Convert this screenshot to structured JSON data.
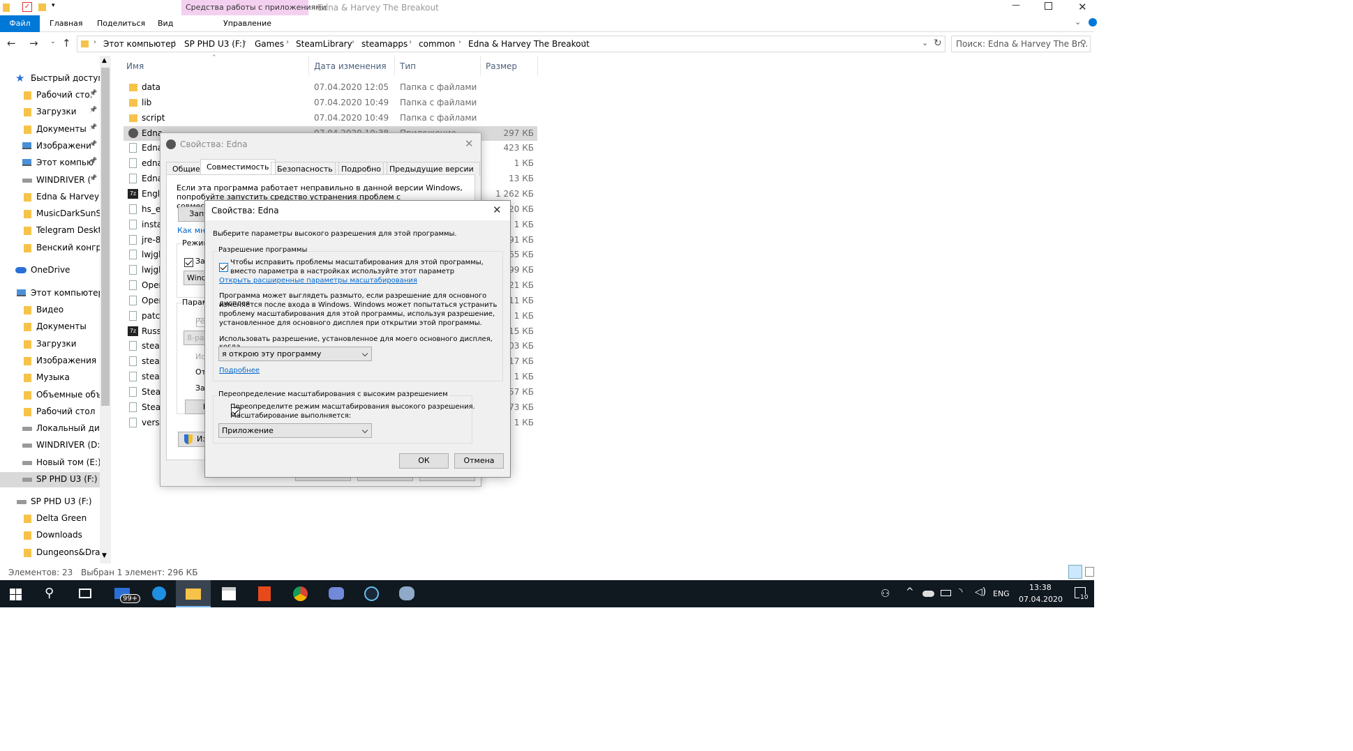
{
  "window": {
    "title": "Edna & Harvey The Breakout",
    "context_tab_group": "Средства работы с приложениями"
  },
  "ribbon": {
    "tabs": [
      "Файл",
      "Главная",
      "Поделиться",
      "Вид"
    ],
    "context_tab": "Управление"
  },
  "address": {
    "crumbs": [
      "Этот компьютер",
      "SP PHD U3 (F:)",
      "Games",
      "SteamLibrary",
      "steamapps",
      "common",
      "Edna & Harvey The Breakout"
    ],
    "search_placeholder": "Поиск: Edna & Harvey The Br..."
  },
  "nav": {
    "quick_access": "Быстрый доступ",
    "quick": [
      "Рабочий сто.",
      "Загрузки",
      "Документы",
      "Изображени",
      "Этот компью",
      "WINDRIVER (",
      "Edna & Harvey T",
      "MusicDarkSunSp",
      "Telegram Deskto",
      "Венский конгре"
    ],
    "onedrive": "OneDrive",
    "this_pc": "Этот компьютер",
    "pc": [
      "Видео",
      "Документы",
      "Загрузки",
      "Изображения",
      "Музыка",
      "Объемные объ",
      "Рабочий стол",
      "Локальный дис",
      "WINDRIVER (D:)",
      "Новый том (E:)",
      "SP PHD U3 (F:)"
    ],
    "drive": "SP PHD U3 (F:)",
    "drive_items": [
      "Delta Green",
      "Downloads",
      "Dungeons&Drag"
    ]
  },
  "columns": {
    "name": "Имя",
    "date": "Дата изменения",
    "type": "Тип",
    "size": "Размер"
  },
  "files": [
    {
      "name": "data",
      "date": "07.04.2020 12:05",
      "type": "Папка с файлами",
      "size": ""
    },
    {
      "name": "lib",
      "date": "07.04.2020 10:49",
      "type": "Папка с файлами",
      "size": ""
    },
    {
      "name": "script",
      "date": "07.04.2020 10:49",
      "type": "Папка с файлами",
      "size": ""
    },
    {
      "name": "Edna",
      "date": "07.04.2020 10:38",
      "type": "Приложение",
      "size": "297 КБ"
    },
    {
      "name": "Edna",
      "date": "",
      "type": "",
      "size": "423 КБ"
    },
    {
      "name": "edna",
      "date": "",
      "type": "",
      "size": "1 КБ"
    },
    {
      "name": "Edna",
      "date": "",
      "type": "",
      "size": "13 КБ"
    },
    {
      "name": "Engli",
      "date": "",
      "type": "",
      "size": "1 262 КБ"
    },
    {
      "name": "hs_er",
      "date": "",
      "type": "",
      "size": "20 КБ"
    },
    {
      "name": "insta",
      "date": "",
      "type": "",
      "size": "1 КБ"
    },
    {
      "name": "jre-8",
      "date": "",
      "type": "",
      "size": "91 КБ"
    },
    {
      "name": "lwjgl",
      "date": "",
      "type": "",
      "size": "65 КБ"
    },
    {
      "name": "lwjgl",
      "date": "",
      "type": "",
      "size": "99 КБ"
    },
    {
      "name": "Oper",
      "date": "",
      "type": "",
      "size": "21 КБ"
    },
    {
      "name": "Oper",
      "date": "",
      "type": "",
      "size": "11 КБ"
    },
    {
      "name": "patch",
      "date": "",
      "type": "",
      "size": "1 КБ"
    },
    {
      "name": "Russi",
      "date": "",
      "type": "",
      "size": "15 КБ"
    },
    {
      "name": "stear",
      "date": "",
      "type": "",
      "size": "03 КБ"
    },
    {
      "name": "stear",
      "date": "",
      "type": "",
      "size": "17 КБ"
    },
    {
      "name": "stear",
      "date": "",
      "type": "",
      "size": "1 КБ"
    },
    {
      "name": "Stear",
      "date": "",
      "type": "",
      "size": "57 КБ"
    },
    {
      "name": "Stear",
      "date": "",
      "type": "",
      "size": "73 КБ"
    },
    {
      "name": "versi",
      "date": "",
      "type": "",
      "size": "1 КБ"
    }
  ],
  "status": {
    "count": "Элементов: 23",
    "selected": "Выбран 1 элемент: 296 КБ"
  },
  "props": {
    "title": "Свойства: Edna",
    "tabs": [
      "Общие",
      "Совместимость",
      "Безопасность",
      "Подробно",
      "Предыдущие версии"
    ],
    "intro": "Если эта программа работает неправильно в данной версии Windows, попробуйте запустить средство устранения проблем с совместимостью.",
    "run_btn": "Запу",
    "how_link": "Как мне",
    "mode_label": "Режим",
    "mode_chk": "За",
    "mode_select": "Windo",
    "params_label": "Парам",
    "p1": "Ре",
    "p_select": "8-раз",
    "p2": "Ис",
    "p3": "От",
    "p4": "За",
    "p_btn": "И",
    "all_btn": "Из"
  },
  "dpi": {
    "title": "Свойства: Edna",
    "heading": "Выберите параметры высокого разрешения для этой программы.",
    "group1": "Разрешение программы",
    "chk1_line1": "Чтобы исправить проблемы масштабирования для этой программы,",
    "chk1_line2": "вместо параметра в настройках используйте этот параметр",
    "link1": "Открыть расширенные параметры масштабирования",
    "para1": "Программа может выглядеть размыто, если разрешение для основного дисплея",
    "para2": "изменяется после входа в Windows. Windows может попытаться устранить",
    "para3": "проблему масштабирования для этой программы, используя разрешение,",
    "para4": "установленное для основного дисплея при открытии этой программы.",
    "use_label": "Использовать разрешение, установленное для моего основного дисплея, когда",
    "select1": "я открою эту программу",
    "more_link": "Подробнее",
    "group2": "Переопределение масштабирования с высоким разрешением",
    "chk2_line1": "Переопределите режим масштабирования высокого разрешения.",
    "chk2_line2": "Масштабирование выполняется:",
    "select2": "Приложение",
    "ok": "ОК",
    "cancel": "Отмена"
  },
  "taskbar": {
    "lang": "ENG",
    "time": "13:38",
    "date": "07.04.2020",
    "mail_badge": "99+",
    "notif": "10"
  },
  "colors": {
    "accent": "#0078d7",
    "context": "#f4d0f0",
    "selected": "#cce8ff",
    "link": "#0066cc"
  }
}
